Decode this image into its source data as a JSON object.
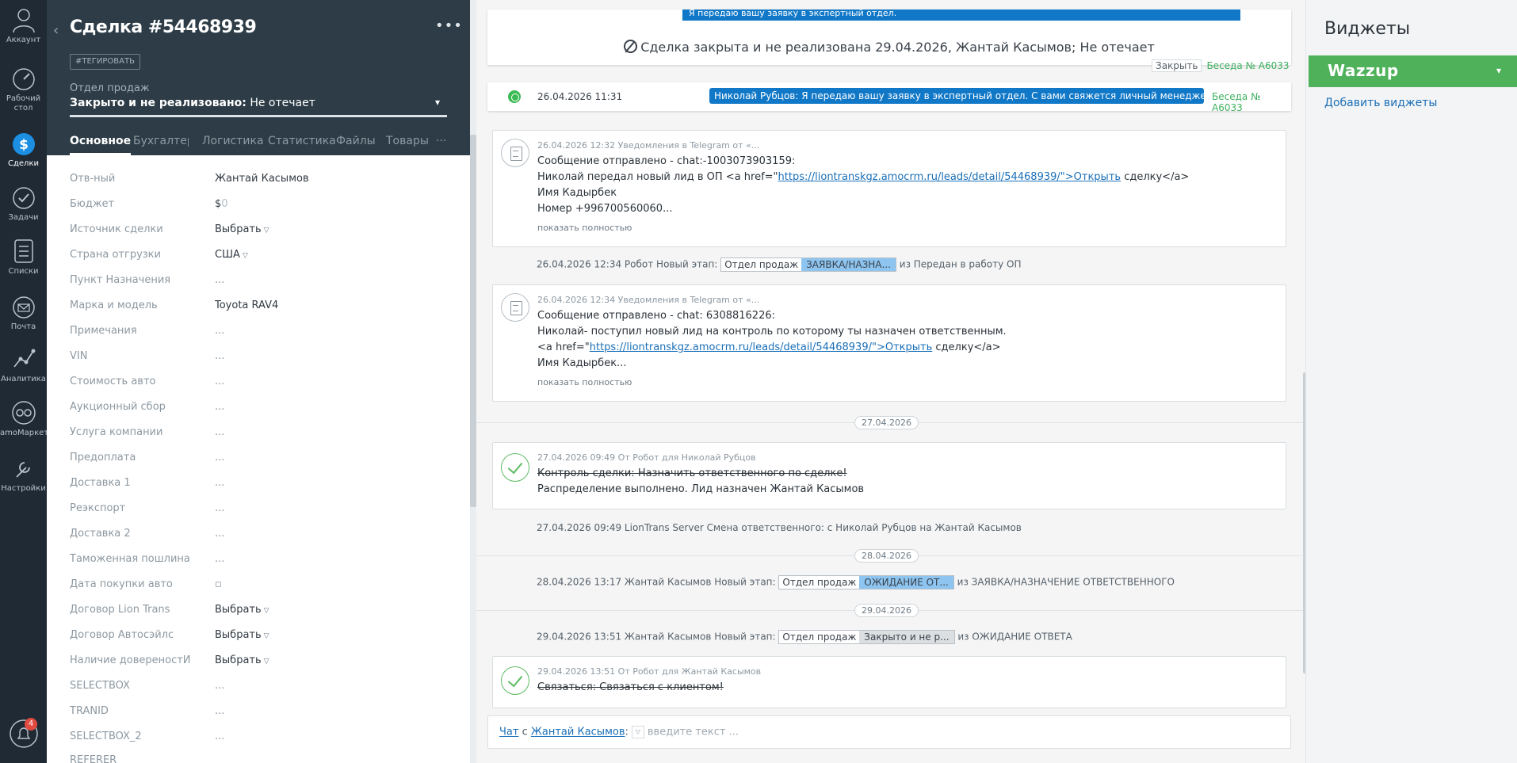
{
  "nav": {
    "items": [
      {
        "label": "Аккаунт",
        "icon": "user-icon"
      },
      {
        "label": "Рабочий стол",
        "icon": "dashboard-icon"
      },
      {
        "label": "Сделки",
        "icon": "deals-icon"
      },
      {
        "label": "Задачи",
        "icon": "tasks-icon"
      },
      {
        "label": "Списки",
        "icon": "lists-icon"
      },
      {
        "label": "Почта",
        "icon": "mail-icon"
      },
      {
        "label": "Аналитика",
        "icon": "analytics-icon"
      },
      {
        "label": "amoМаркет",
        "icon": "market-icon"
      },
      {
        "label": "Настройки",
        "icon": "settings-icon"
      }
    ],
    "notifications_count": "4"
  },
  "card": {
    "title": "Сделка #54468939",
    "tag_button": "#ТЕГИРОВАТЬ",
    "pipeline": "Отдел продаж",
    "status_bold": "Закрыто и не реализовано:",
    "status_reason": " Не отечает",
    "tabs": [
      "Основное",
      "Бухгалтер",
      "Логистика",
      "Статистика",
      "Файлы",
      "Товары"
    ],
    "fields": [
      {
        "label": "Отв-ный",
        "value": "Жантай Касымов"
      },
      {
        "label": "Бюджет",
        "value": "$",
        "extra": "0"
      },
      {
        "label": "Источник сделки",
        "value": "Выбрать"
      },
      {
        "label": "Страна отгрузки",
        "value": "США"
      },
      {
        "label": "Пункт Назначения",
        "value": "..."
      },
      {
        "label": "Марка и модель",
        "value": "Toyota RAV4"
      },
      {
        "label": "Примечания",
        "value": "..."
      },
      {
        "label": "VIN",
        "value": "..."
      },
      {
        "label": "Стоимость авто",
        "value": "..."
      },
      {
        "label": "Аукционный сбор",
        "value": "..."
      },
      {
        "label": "Услуга компании",
        "value": "..."
      },
      {
        "label": "Предоплата",
        "value": "..."
      },
      {
        "label": "Доставка 1",
        "value": "..."
      },
      {
        "label": "Реэкспорт",
        "value": "..."
      },
      {
        "label": "Доставка 2",
        "value": "..."
      },
      {
        "label": "Таможенная пошлина",
        "value": "..."
      },
      {
        "label": "Дата покупки авто",
        "value": "▫"
      },
      {
        "label": "Договор Lion Trans",
        "value": "Выбрать"
      },
      {
        "label": "Договор Автосэйлс",
        "value": "Выбрать"
      },
      {
        "label": "Наличие довереностИ",
        "value": "Выбрать"
      },
      {
        "label": "SELECTBOX",
        "value": "..."
      },
      {
        "label": "TRANID",
        "value": "..."
      },
      {
        "label": "SELECTBOX_2",
        "value": "..."
      },
      {
        "label": "REFERER",
        "value": ""
      }
    ]
  },
  "feed": {
    "banner_top": "Я передаю вашу заявку в экспертный отдел.",
    "banner": "Сделка закрыта и не реализована 29.04.2026, Жантай Касымов; Не отечает",
    "close_btn": "Закрыть",
    "beseda": "Беседа № A6033",
    "wa": {
      "date": "26.04.2026 11:31",
      "message": "Николай Рубцов: Я передаю вашу заявку в экспертный отдел. С вами свяжется личный менеджер, которы...",
      "beseda": "Беседа № A6033"
    },
    "note1": {
      "meta": "26.04.2026 12:32 Уведомления в Telegram от «...",
      "l1": "Сообщение отправлено - chat:-1003073903159:",
      "l2a": "Николай передал новый лид в ОП <a href=\"",
      "link": "https://liontranskgz.amocrm.ru/leads/detail/54468939/\">Открыть",
      "l2b": " сделку</a>",
      "l3": "Имя Кадырбек",
      "l4": "Номер +996700560060...",
      "more": "показать полностью"
    },
    "sys1": {
      "text": "26.04.2026 12:34 Робот Новый этап:",
      "pipe": "Отдел продаж",
      "stage": "ЗАЯВКА/НАЗНА...",
      "from": "из Передан в работу ОП"
    },
    "note2": {
      "meta": "26.04.2026 12:34 Уведомления в Telegram от «...",
      "l1": "Сообщение отправлено - chat: 6308816226:",
      "l2": "Николай- поступил новый лид на контроль по которому ты назначен ответственным.",
      "l3a": "<a href=\"",
      "link": "https://liontranskgz.amocrm.ru/leads/detail/54468939/\">Открыть",
      "l3b": " сделку</a>",
      "l4": "Имя Кадырбек...",
      "more": "показать полностью"
    },
    "day1": "27.04.2026",
    "task1": {
      "meta": "27.04.2026 09:49  От Робот для Николай Рубцов",
      "l1": "Контроль сделки: Назначить ответственного по сделке!",
      "l2": "Распределение выполнено. Лид назначен Жантай Касымов"
    },
    "sys2": "27.04.2026 09:49 LionTrans Server Смена ответственного: с Николай Рубцов на Жантай Касымов",
    "day2": "28.04.2026",
    "sys3": {
      "text": "28.04.2026 13:17 Жантай Касымов Новый этап:",
      "pipe": "Отдел продаж",
      "stage": "ОЖИДАНИЕ ОТ...",
      "from": "из ЗАЯВКА/НАЗНАЧЕНИЕ ОТВЕТСТВЕННОГО"
    },
    "day3": "29.04.2026",
    "sys4": {
      "text": "29.04.2026 13:51 Жантай Касымов Новый этап:",
      "pipe": "Отдел продаж",
      "stage": "Закрыто и не р...",
      "from": "из ОЖИДАНИЕ ОТВЕТА"
    },
    "task2": {
      "meta": "29.04.2026 13:51  От Робот для Жантай Касымов",
      "l1": "Связаться: Связаться с клиентом!"
    },
    "chat": {
      "label": "Чат",
      "with": " с ",
      "user": "Жантай Касымов",
      "colon": ":",
      "placeholder": "введите текст ..."
    },
    "colors": {
      "accent": "#1178c8",
      "success": "#4fb25b",
      "stage_blue": "#8ec5f0",
      "stage_grey": "#dcdfe2"
    }
  },
  "widgets": {
    "title": "Виджеты",
    "wazzup": "Wazzup",
    "add": "Добавить виджеты"
  }
}
